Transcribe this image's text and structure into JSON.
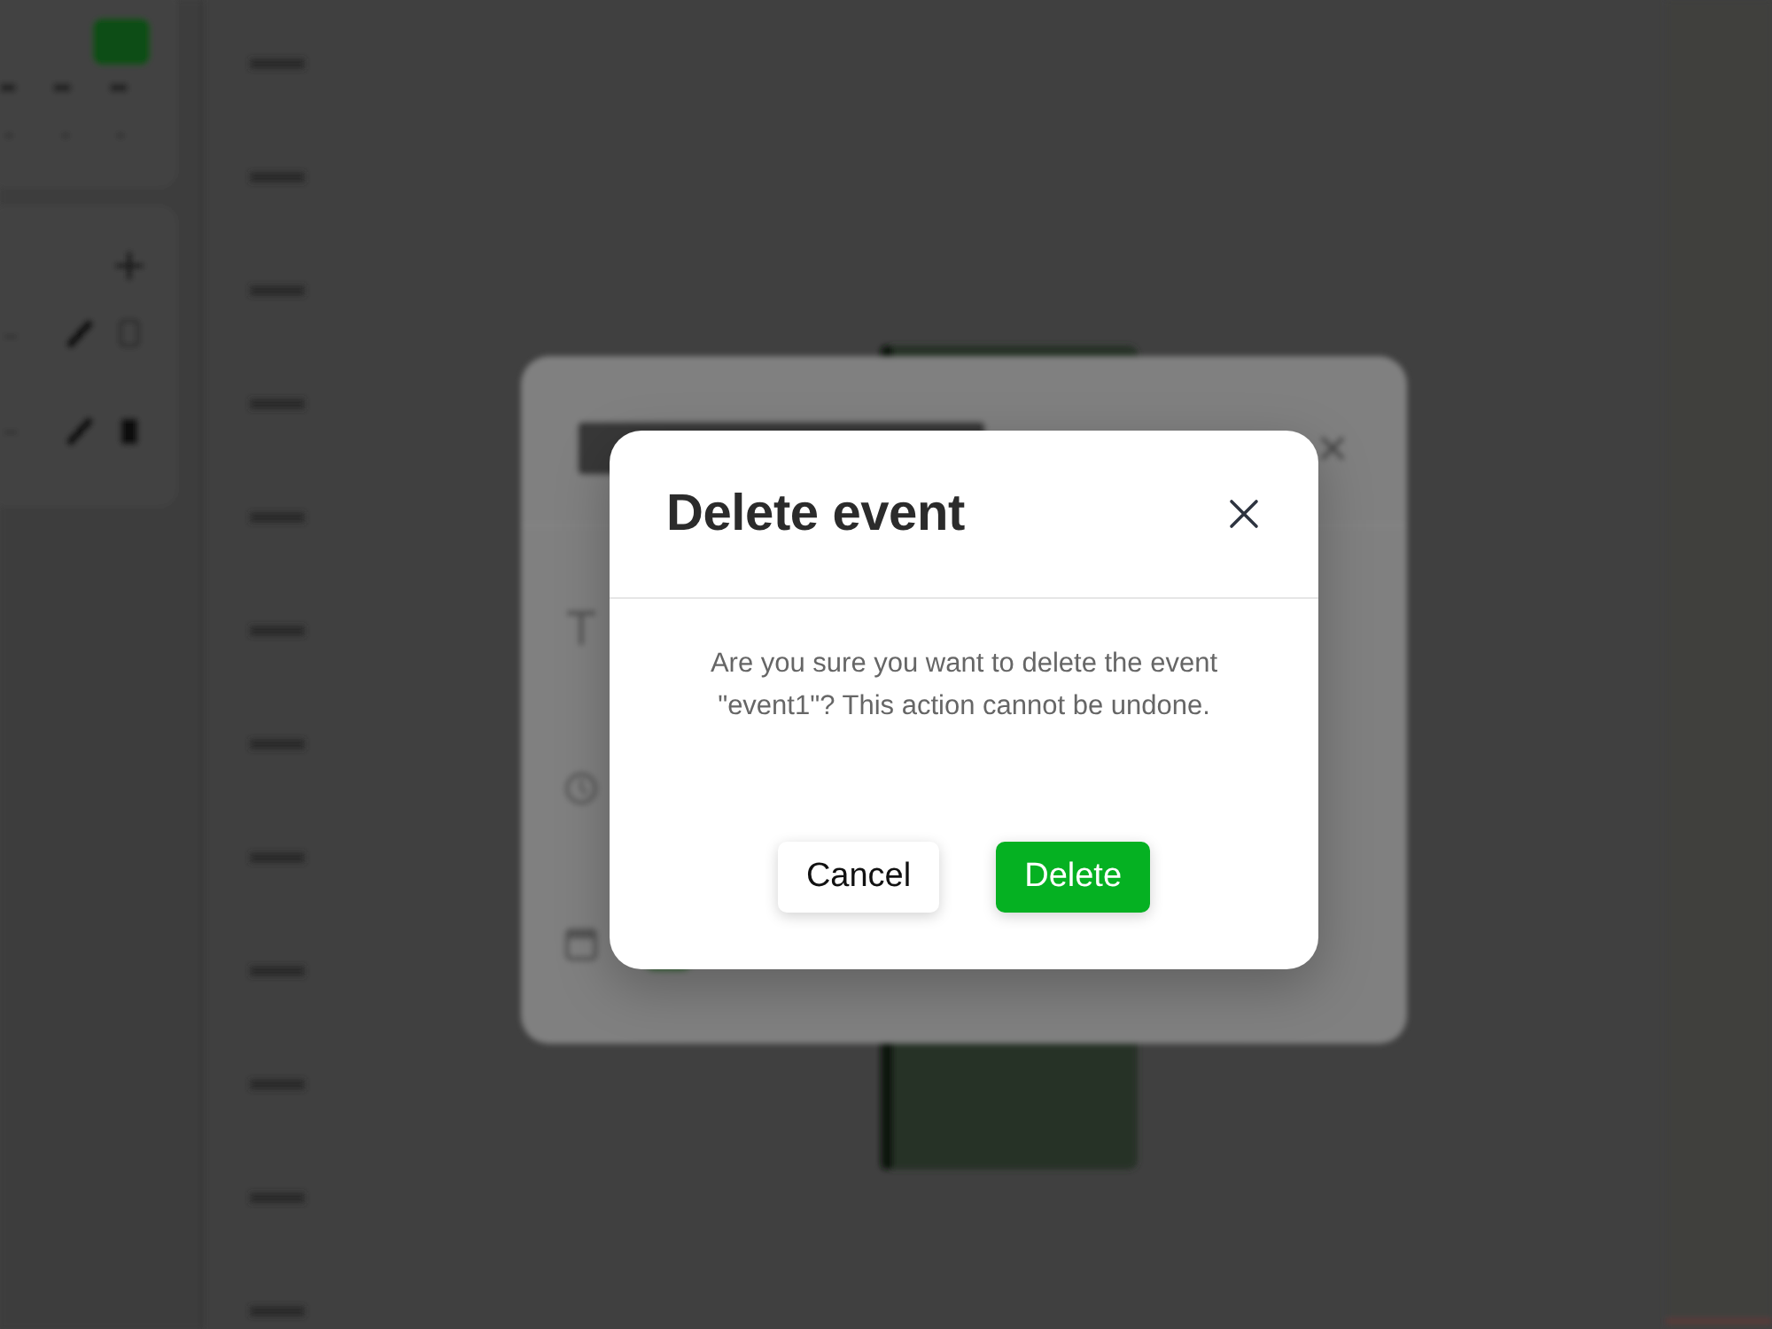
{
  "dialog": {
    "title": "Delete event",
    "message": "Are you sure you want to delete the event \"event1\"? This action cannot be undone.",
    "buttons": [
      {
        "label": "Cancel",
        "kind": "secondary"
      },
      {
        "label": "Delete",
        "kind": "primary"
      }
    ]
  }
}
